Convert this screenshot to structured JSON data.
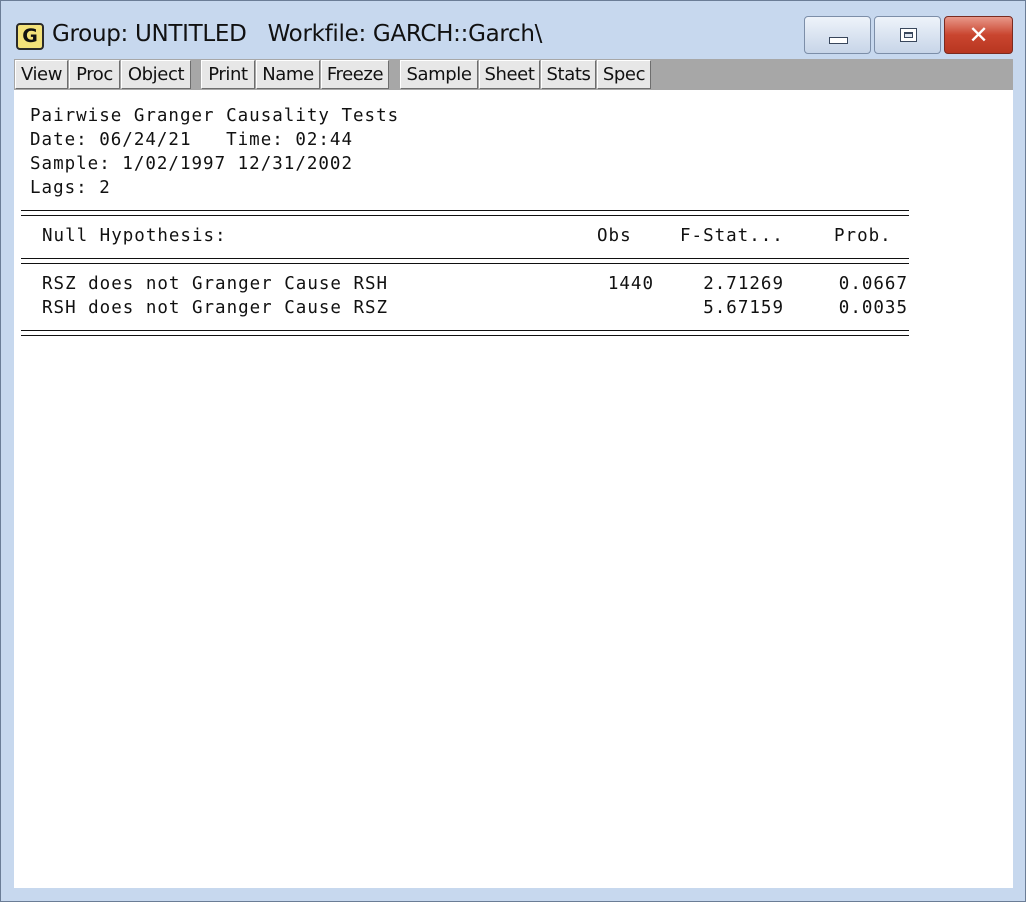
{
  "window": {
    "icon_letter": "G",
    "title": "Group: UNTITLED   Workfile: GARCH::Garch\\",
    "controls": {
      "close_glyph": "✕"
    }
  },
  "toolbar": {
    "buttons": [
      "View",
      "Proc",
      "Object",
      "Print",
      "Name",
      "Freeze",
      "Sample",
      "Sheet",
      "Stats",
      "Spec"
    ]
  },
  "report": {
    "title": "Pairwise Granger Causality Tests",
    "date_line": "Date: 06/24/21   Time: 02:44",
    "sample_line": "Sample: 1/02/1997 12/31/2002",
    "lags_line": "Lags: 2",
    "columns": {
      "hypothesis": "Null Hypothesis:",
      "obs": "Obs",
      "fstat": "F-Stat...",
      "prob": "Prob."
    },
    "rows": [
      {
        "hypothesis": "RSZ does not Granger Cause RSH",
        "obs": "1440",
        "fstat": "2.71269",
        "prob": "0.0667"
      },
      {
        "hypothesis": "RSH does not Granger Cause RSZ",
        "obs": "",
        "fstat": "5.67159",
        "prob": "0.0035"
      }
    ]
  }
}
